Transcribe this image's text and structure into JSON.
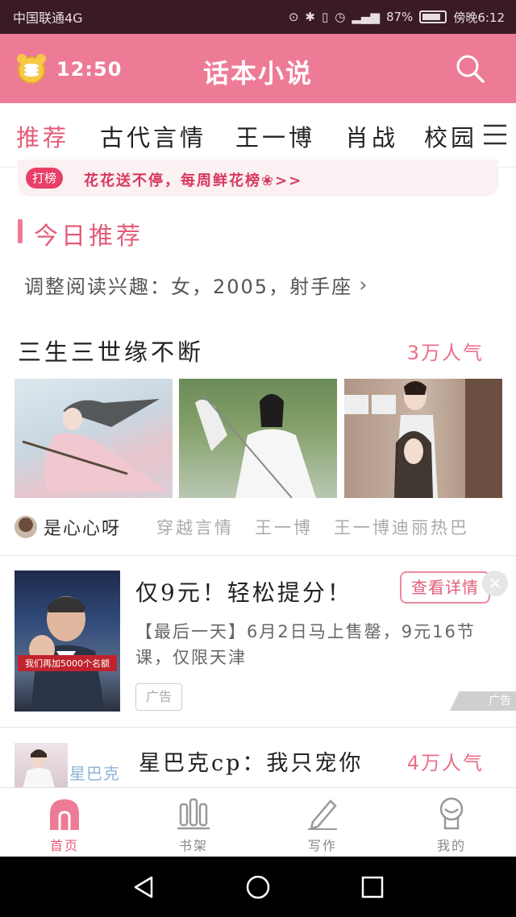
{
  "status_bar": {
    "carrier": "中国联通4G",
    "battery": "87%",
    "time": "傍晚6:12"
  },
  "header": {
    "time": "12:50",
    "title": "话本小说"
  },
  "tabs": [
    {
      "label": "推荐",
      "active": true
    },
    {
      "label": "古代言情",
      "active": false
    },
    {
      "label": "王一博",
      "active": false
    },
    {
      "label": "肖战",
      "active": false
    },
    {
      "label": "校园",
      "active": false
    }
  ],
  "banner": {
    "badge": "打榜",
    "text": "花花送不停，每周鲜花榜❀>>"
  },
  "recommend": {
    "section_title": "今日推荐",
    "adjust_interest": "调整阅读兴趣：女，2005，射手座"
  },
  "book1": {
    "title": "三生三世缘不断",
    "popularity": "3万人气",
    "author": "是心心呀",
    "tags": [
      "穿越言情",
      "王一博",
      "王一博迪丽热巴"
    ]
  },
  "ad": {
    "title": "仅9元！轻松提分！",
    "button": "查看详情",
    "description": "【最后一天】6月2日马上售罄，9元16节课，仅限天津",
    "tag": "广告",
    "mark": "广告",
    "image_caption": "我们再加5000个名额"
  },
  "book2": {
    "title": "星巴克cp：我只宠你",
    "popularity": "4万人气",
    "image_text": "星巴克"
  },
  "bottom_nav": [
    {
      "label": "首页",
      "icon": "home-icon",
      "active": true
    },
    {
      "label": "书架",
      "icon": "bookshelf-icon",
      "active": false
    },
    {
      "label": "写作",
      "icon": "pencil-icon",
      "active": false
    },
    {
      "label": "我的",
      "icon": "profile-icon",
      "active": false
    }
  ],
  "colors": {
    "accent": "#ee7b95",
    "accent_dark": "#e35c78",
    "status_bar": "#3a1a26"
  }
}
